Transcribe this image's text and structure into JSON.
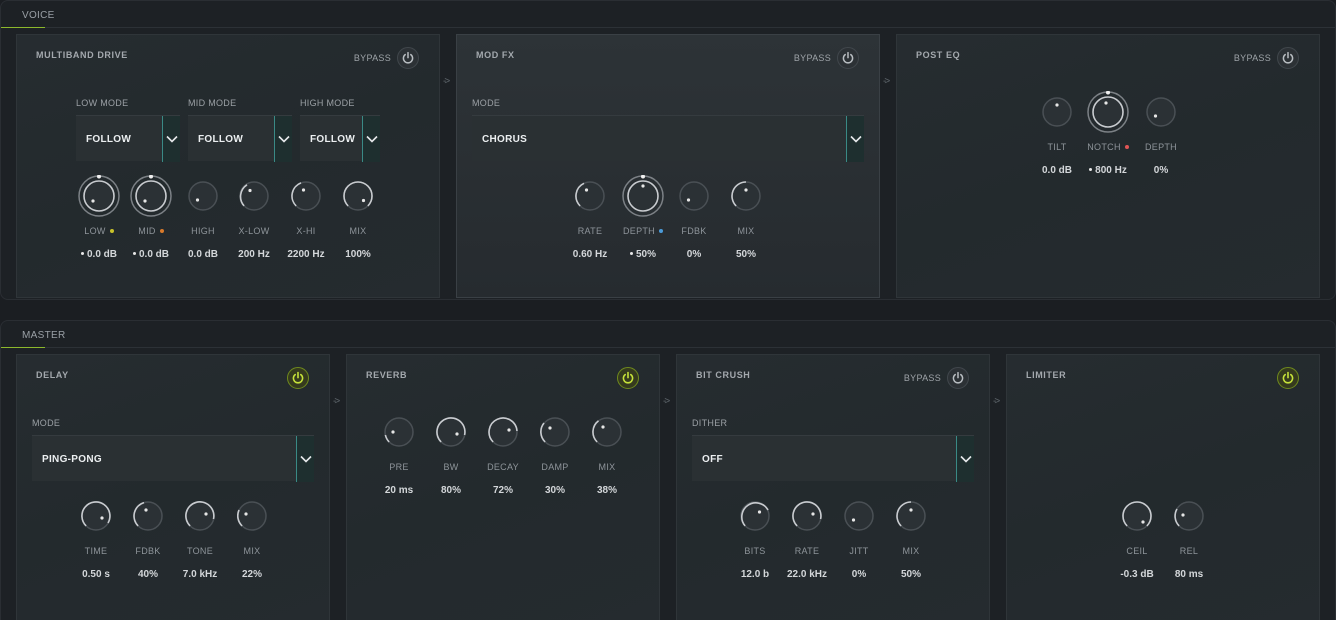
{
  "colors": {
    "accent": "#b5d334",
    "yellow_dot": "#c8c22a",
    "orange_dot": "#d97a2b",
    "blue_dot": "#4b9bd9",
    "red_dot": "#e05555"
  },
  "voice": {
    "title": "VOICE",
    "multiband": {
      "title": "MULTIBAND DRIVE",
      "bypass": "BYPASS",
      "low_mode_label": "LOW MODE",
      "low_mode": "FOLLOW",
      "mid_mode_label": "MID MODE",
      "mid_mode": "FOLLOW",
      "high_mode_label": "HIGH MODE",
      "high_mode": "FOLLOW",
      "knobs": [
        {
          "label": "LOW",
          "value": "0.0 dB"
        },
        {
          "label": "MID",
          "value": "0.0 dB"
        },
        {
          "label": "HIGH",
          "value": "0.0 dB"
        },
        {
          "label": "X-LOW",
          "value": "200 Hz"
        },
        {
          "label": "X-HI",
          "value": "2200 Hz"
        },
        {
          "label": "MIX",
          "value": "100%"
        }
      ]
    },
    "modfx": {
      "title": "MOD FX",
      "bypass": "BYPASS",
      "mode_label": "MODE",
      "mode": "CHORUS",
      "knobs": [
        {
          "label": "RATE",
          "value": "0.60 Hz"
        },
        {
          "label": "DEPTH",
          "value": "50%"
        },
        {
          "label": "FDBK",
          "value": "0%"
        },
        {
          "label": "MIX",
          "value": "50%"
        }
      ]
    },
    "posteq": {
      "title": "POST EQ",
      "bypass": "BYPASS",
      "knobs": [
        {
          "label": "TILT",
          "value": "0.0 dB"
        },
        {
          "label": "NOTCH",
          "value": "800 Hz"
        },
        {
          "label": "DEPTH",
          "value": "0%"
        }
      ]
    }
  },
  "master": {
    "title": "MASTER",
    "delay": {
      "title": "DELAY",
      "mode_label": "MODE",
      "mode": "PING-PONG",
      "knobs": [
        {
          "label": "TIME",
          "value": "0.50 s"
        },
        {
          "label": "FDBK",
          "value": "40%"
        },
        {
          "label": "TONE",
          "value": "7.0 kHz"
        },
        {
          "label": "MIX",
          "value": "22%"
        }
      ]
    },
    "reverb": {
      "title": "REVERB",
      "knobs": [
        {
          "label": "PRE",
          "value": "20 ms"
        },
        {
          "label": "BW",
          "value": "80%"
        },
        {
          "label": "DECAY",
          "value": "72%"
        },
        {
          "label": "DAMP",
          "value": "30%"
        },
        {
          "label": "MIX",
          "value": "38%"
        }
      ]
    },
    "bitcrush": {
      "title": "BIT CRUSH",
      "bypass": "BYPASS",
      "dither_label": "DITHER",
      "dither": "OFF",
      "knobs": [
        {
          "label": "BITS",
          "value": "12.0 b"
        },
        {
          "label": "RATE",
          "value": "22.0 kHz"
        },
        {
          "label": "JITT",
          "value": "0%"
        },
        {
          "label": "MIX",
          "value": "50%"
        }
      ]
    },
    "limiter": {
      "title": "LIMITER",
      "knobs": [
        {
          "label": "CEIL",
          "value": "-0.3 dB"
        },
        {
          "label": "REL",
          "value": "80 ms"
        }
      ]
    }
  },
  "icons": {
    "power": "power-icon",
    "chevron": "chevron-down-icon",
    "arrow": "->"
  }
}
